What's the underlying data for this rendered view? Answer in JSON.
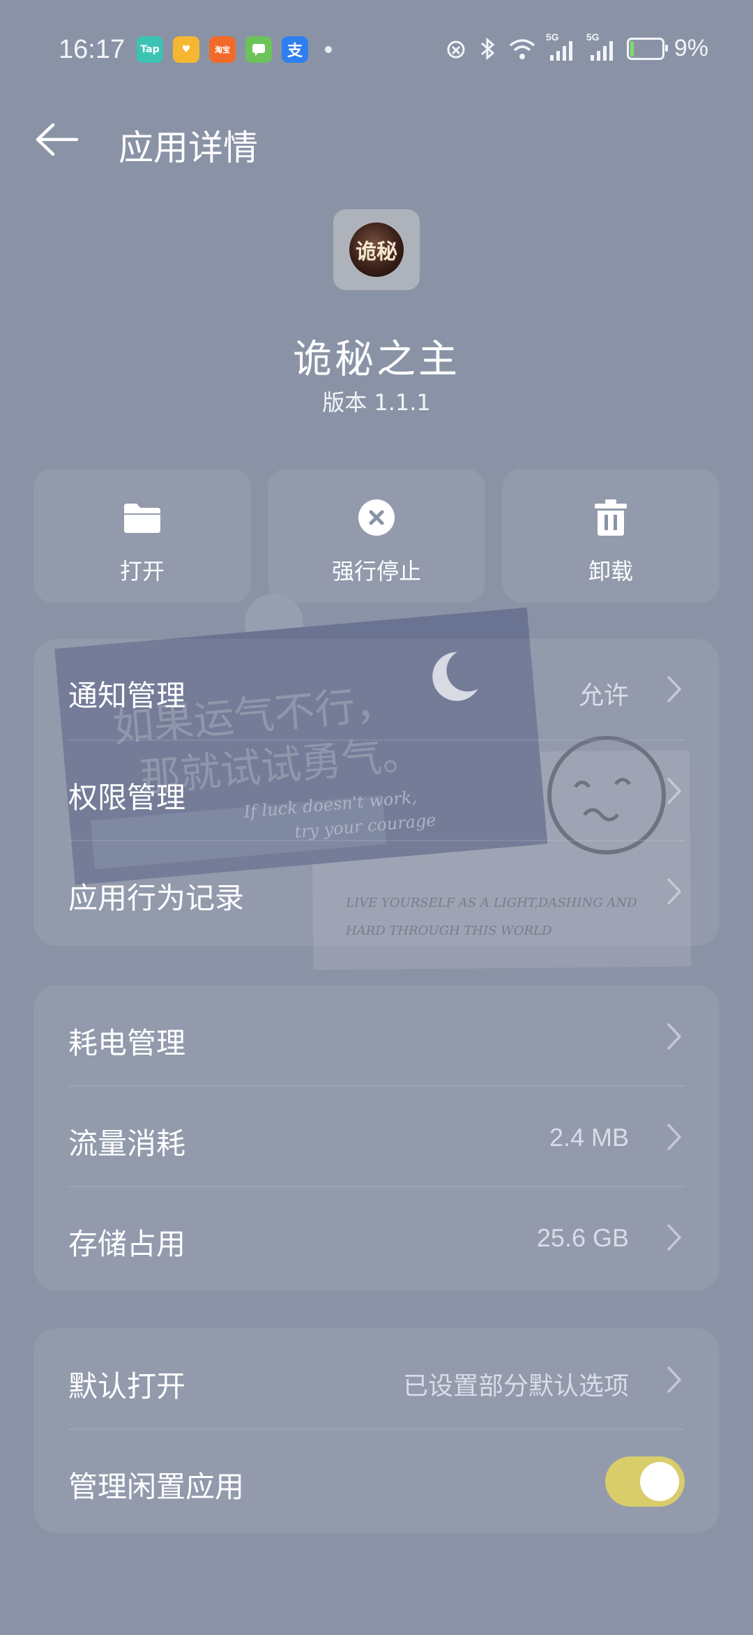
{
  "status_bar": {
    "time": "16:17",
    "apps": [
      {
        "name": "taptap-icon",
        "label": "Tap",
        "color": "#3cc3b4"
      },
      {
        "name": "xianyu-icon",
        "label": "♥",
        "color": "#f5b731"
      },
      {
        "name": "taobao-shangou-icon",
        "label": "淘宝",
        "color": "#f26a2a"
      },
      {
        "name": "message-icon",
        "label": "",
        "color": "#6cc35a"
      },
      {
        "name": "alipay-icon",
        "label": "支",
        "color": "#2f7ff0"
      }
    ],
    "battery": "9%",
    "network_labels": [
      "5G",
      "5G"
    ]
  },
  "header": {
    "title": "应用详情"
  },
  "app": {
    "name": "诡秘之主",
    "version": "版本 1.1.1",
    "icon_text": "诡秘"
  },
  "actions": [
    {
      "label": "打开",
      "icon": "folder-icon"
    },
    {
      "label": "强行停止",
      "icon": "close-circle-icon"
    },
    {
      "label": "卸载",
      "icon": "trash-icon"
    }
  ],
  "wallpaper": {
    "chinese_line_1": "如果运气不行，",
    "chinese_line_2": "那就试试勇气。",
    "english_line_1": "If luck doesn't work,",
    "english_line_2": "try your courage",
    "bottom_line_1": "LIVE YOURSELF AS A LIGHT,DASHING AND",
    "bottom_line_2": "HARD THROUGH THIS WORLD"
  },
  "card1": [
    {
      "label": "通知管理",
      "value": "允许"
    },
    {
      "label": "权限管理",
      "value": ""
    },
    {
      "label": "应用行为记录",
      "value": ""
    }
  ],
  "card2": [
    {
      "label": "耗电管理",
      "value": ""
    },
    {
      "label": "流量消耗",
      "value": "2.4 MB"
    },
    {
      "label": "存储占用",
      "value": "25.6 GB"
    }
  ],
  "card3": {
    "default_open": {
      "label": "默认打开",
      "value": "已设置部分默认选项"
    },
    "idle_manage": {
      "label": "管理闲置应用",
      "enabled": true
    }
  },
  "colors": {
    "background": "#8a93a6",
    "toggle_on": "#d9cd6b"
  }
}
